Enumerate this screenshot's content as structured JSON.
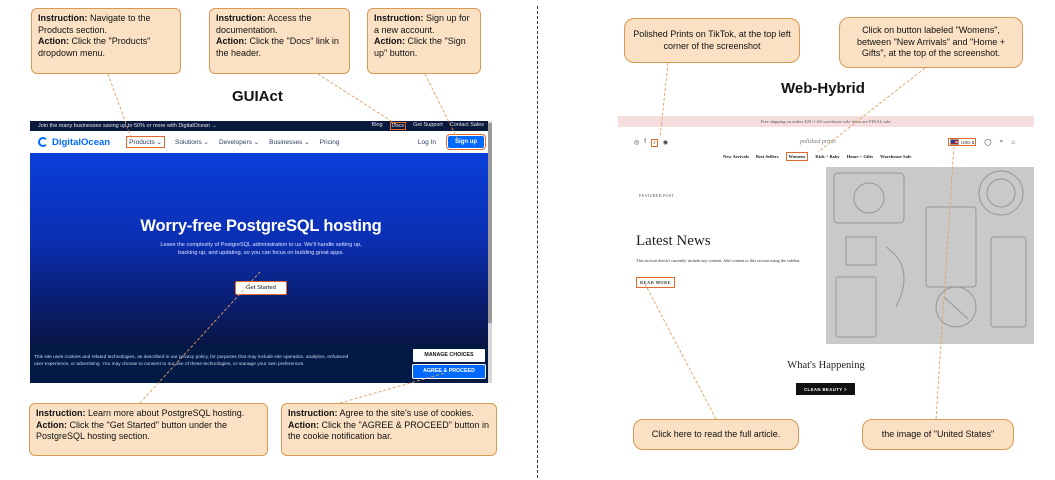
{
  "titles": {
    "left": "GUIAct",
    "right": "Web-Hybrid"
  },
  "left_callouts": {
    "c1": {
      "instruction_label": "Instruction:",
      "instruction": "Navigate to the Products section.",
      "action_label": "Action:",
      "action": "Click the \"Products\" dropdown menu."
    },
    "c2": {
      "instruction_label": "Instruction:",
      "instruction": "Access the documentation.",
      "action_label": "Action:",
      "action": "Click the \"Docs\" link in the header."
    },
    "c3": {
      "instruction_label": "Instruction:",
      "instruction": "Sign up for a new account.",
      "action_label": "Action:",
      "action": "Click the \"Sign up\" button."
    },
    "c4": {
      "instruction_label": "Instruction:",
      "instruction": "Learn more about PostgreSQL hosting.",
      "action_label": "Action:",
      "action": "Click the \"Get Started\" button under the PostgreSQL hosting section."
    },
    "c5": {
      "instruction_label": "Instruction:",
      "instruction": "Agree to the site's use of cookies.",
      "action_label": "Action:",
      "action": "Click the \"AGREE & PROCEED\" button in the cookie notification bar."
    }
  },
  "right_notes": {
    "n1": "Polished Prints on TikTok, at the top left corner of the screenshot",
    "n2": "Click on button labeled \"Womens\", between \"New Arrivals\" and \"Home + Gifts\", at the top of the screenshot.",
    "n3": "Click here to read the full article.",
    "n4": "the image of \"United States\""
  },
  "digitalocean": {
    "banner": "Join the many businesses saving up to 50% or more with DigitalOcean →",
    "top_links": [
      "Blog",
      "Docs",
      "Get Support",
      "Contact Sales"
    ],
    "logo": "DigitalOcean",
    "nav": [
      "Products ⌄",
      "Solutions ⌄",
      "Developers ⌄",
      "Businesses ⌄",
      "Pricing"
    ],
    "login": "Log In",
    "signup": "Sign up",
    "hero_title": "Worry-free PostgreSQL hosting",
    "hero_text": "Leave the complexity of PostgreSQL administration to us. We'll handle setting up, backing up, and updating, so you can focus on building great apps.",
    "get_started": "Get Started",
    "cookie_text": "This site uses cookies and related technologies, as described in our privacy policy, for purposes that may include site operation, analytics, enhanced user experience, or advertising. You may choose to consent to our use of these technologies, or manage your own preferences.",
    "manage": "MANAGE CHOICES",
    "agree": "AGREE & PROCEED"
  },
  "polished": {
    "announcement": "Free shipping on orders $25+! All warehouse sale items are FINAL sale.",
    "logo": "polished prints",
    "social": [
      "◎",
      "f",
      "♪",
      "◉"
    ],
    "currency": "USD $",
    "menu": [
      "New Arrivals",
      "Best Sellers",
      "Womens",
      "Kids + Baby",
      "Home + Gifts",
      "Warehouse Sale"
    ],
    "featured": "FEATURED POST",
    "headline": "Latest News",
    "body": "This section doesn't currently include any content. Add content to this section using the sidebar.",
    "read_more": "READ MORE",
    "whats": "What's Happening",
    "clean": "CLEAN BEAUTY >"
  }
}
